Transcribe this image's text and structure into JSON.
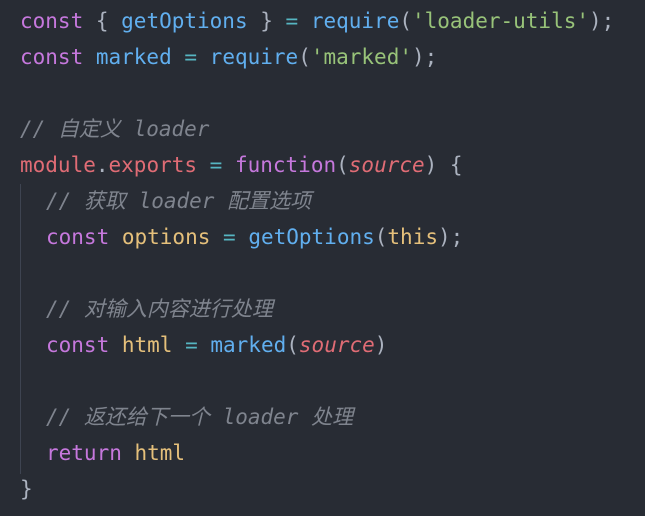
{
  "code": {
    "l1": {
      "const": "const",
      "brace_open": " { ",
      "getOptions": "getOptions",
      "brace_close": " } ",
      "eq": "=",
      "require": " require",
      "paren_open": "(",
      "module_str": "'loader-utils'",
      "paren_close": ");"
    },
    "l2": {
      "const": "const",
      "marked": " marked ",
      "eq": "=",
      "require": " require",
      "paren_open": "(",
      "module_str": "'marked'",
      "paren_close": ");"
    },
    "l4": {
      "comment": "// 自定义 loader"
    },
    "l5": {
      "module": "module",
      "dot": ".",
      "exports": "exports",
      "eq": " = ",
      "function": "function",
      "paren_open": "(",
      "param": "source",
      "paren_close": ") {"
    },
    "l6": {
      "comment": "// 获取 loader 配置选项"
    },
    "l7": {
      "const": "const",
      "options": " options ",
      "eq": "=",
      "getOptions": " getOptions",
      "paren_open": "(",
      "this": "this",
      "paren_close": ");"
    },
    "l9": {
      "comment": "// 对输入内容进行处理"
    },
    "l10": {
      "const": "const",
      "html": " html ",
      "eq": "=",
      "marked": " marked",
      "paren_open": "(",
      "param": "source",
      "paren_close": ")"
    },
    "l12": {
      "comment": "// 返还给下一个 loader 处理"
    },
    "l13": {
      "return": "return",
      "html": " html"
    },
    "l14": {
      "close": "}"
    }
  }
}
